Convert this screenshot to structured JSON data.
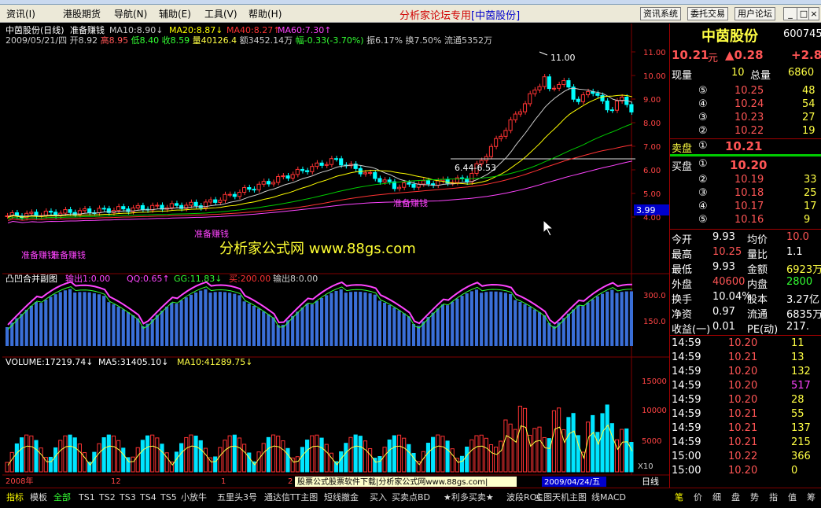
{
  "menubar": {
    "items": [
      "资讯(I)",
      "港股期货",
      "导航(N)",
      "辅助(E)",
      "工具(V)",
      "帮助(H)"
    ],
    "forum_text": "分析家论坛专用",
    "forum_link": "[中茵股份]",
    "buttons": [
      "资讯系统",
      "委托交易",
      "用户论坛"
    ],
    "win_buttons": [
      "_",
      "□",
      "×"
    ]
  },
  "price_chart": {
    "title": "中茵股份(日线)",
    "label": "准备赚钱",
    "ma": [
      "MA10:8.90↓",
      "MA20:8.87↓",
      "MA40:8.27↑",
      "MA60:7.30↑"
    ],
    "info_date": "2009/05/21/四",
    "info_open_label": "开",
    "info_open": "8.92",
    "info_high_label": "高",
    "info_high": "8.95",
    "info_low_label": "低",
    "info_low": "8.40",
    "info_close_label": "收",
    "info_close": "8.59",
    "info_vol_label": "量",
    "info_vol": "40126.4",
    "info_amt": "额3452.14万",
    "info_chg": "幅-0.33(-3.70%)",
    "info_rest": "振6.17% 换7.50% 流通5352万",
    "high_label": "11.00",
    "range_label": "6.44-6.53",
    "last_price": "3.99",
    "watermark": "分析家公式网 www.88gs.com",
    "signals": [
      "准备赚钱",
      "准备赚钱",
      "准备赚钱",
      "准备赚钱"
    ],
    "yticks": [
      "11.00",
      "10.00",
      "9.00",
      "8.00",
      "7.00",
      "6.00",
      "5.00",
      "4.00"
    ]
  },
  "sub_chart": {
    "name": "凸凹合并副图",
    "vals": [
      "输出1:0.00",
      "QQ:0.65↑",
      "GG:11.83↓",
      "买:200.00",
      "输出8:0.00"
    ],
    "yticks": [
      "300.0",
      "150.0"
    ]
  },
  "volume_chart": {
    "vals": [
      "VOLUME:17219.74↓",
      "MA5:31405.10↓",
      "MA10:41289.75↓"
    ],
    "yticks": [
      "15000",
      "10000",
      "5000"
    ],
    "x10": "X10"
  },
  "date_axis": {
    "labels": [
      "2008年",
      "12",
      "1",
      "2"
    ],
    "hover_date": "2009/04/24/五",
    "download": "股票公式股票软件下载|分析家公式网www.88gs.com|",
    "period": "日线"
  },
  "bottom_tabs": [
    "指标",
    "模板",
    "全部",
    "TS1",
    "TS2",
    "TS3",
    "TS4",
    "TS5",
    "小放牛",
    "五里头3号",
    "通达信TT主图",
    "短线撤金",
    "买入",
    "买卖点BD",
    "★利多买卖★",
    "波段ROC",
    "主图天机主图",
    "线MACD"
  ],
  "right_tabs": [
    "笔",
    "价",
    "细",
    "盘",
    "势",
    "指",
    "值",
    "筹"
  ],
  "quote": {
    "name": "中茵股份",
    "code": "600745",
    "price": "10.21",
    "unit": "元",
    "change": "▲0.28",
    "pct": "+2.8",
    "xianliang_label": "现量",
    "xianliang": "10",
    "zongliang_label": "总量",
    "zongliang": "6860",
    "asks": [
      {
        "lvl": "⑤",
        "p": "10.25",
        "v": "48"
      },
      {
        "lvl": "④",
        "p": "10.24",
        "v": "54"
      },
      {
        "lvl": "③",
        "p": "10.23",
        "v": "27"
      },
      {
        "lvl": "②",
        "p": "10.22",
        "v": "19"
      }
    ],
    "ask1_label": "卖盘",
    "ask1_lvl": "①",
    "ask1_p": "10.21",
    "bid1_label": "买盘",
    "bid1_lvl": "①",
    "bid1_p": "10.20",
    "bids": [
      {
        "lvl": "②",
        "p": "10.19",
        "v": "33"
      },
      {
        "lvl": "③",
        "p": "10.18",
        "v": "25"
      },
      {
        "lvl": "④",
        "p": "10.17",
        "v": "17"
      },
      {
        "lvl": "⑤",
        "p": "10.16",
        "v": "9"
      }
    ],
    "stats": [
      [
        "今开",
        "9.93",
        "均价",
        "10.0"
      ],
      [
        "最高",
        "10.25",
        "量比",
        "1.1"
      ],
      [
        "最低",
        "9.93",
        "金额",
        "6923万"
      ],
      [
        "外盘",
        "40600",
        "内盘",
        "2800"
      ],
      [
        "换手",
        "10.04%",
        "股本",
        "3.27亿"
      ],
      [
        "净资",
        "0.97",
        "流通",
        "6835万"
      ],
      [
        "收益(一)",
        "0.01",
        "PE(动)",
        "217."
      ]
    ],
    "ticks": [
      [
        "14:59",
        "10.20",
        "11"
      ],
      [
        "14:59",
        "10.21",
        "13"
      ],
      [
        "14:59",
        "10.20",
        "132"
      ],
      [
        "14:59",
        "10.20",
        "517"
      ],
      [
        "14:59",
        "10.20",
        "28"
      ],
      [
        "14:59",
        "10.21",
        "55"
      ],
      [
        "14:59",
        "10.21",
        "137"
      ],
      [
        "14:59",
        "10.21",
        "215"
      ],
      [
        "15:00",
        "10.22",
        "366"
      ],
      [
        "15:00",
        "10.20",
        "0"
      ]
    ]
  },
  "colors": {
    "up": "#ff3333",
    "down": "#00ffff",
    "ma10": "#ffffff",
    "ma20": "#ffff00",
    "ma40": "#ff3333",
    "ma60": "#ff44ff",
    "grid": "#800000"
  }
}
